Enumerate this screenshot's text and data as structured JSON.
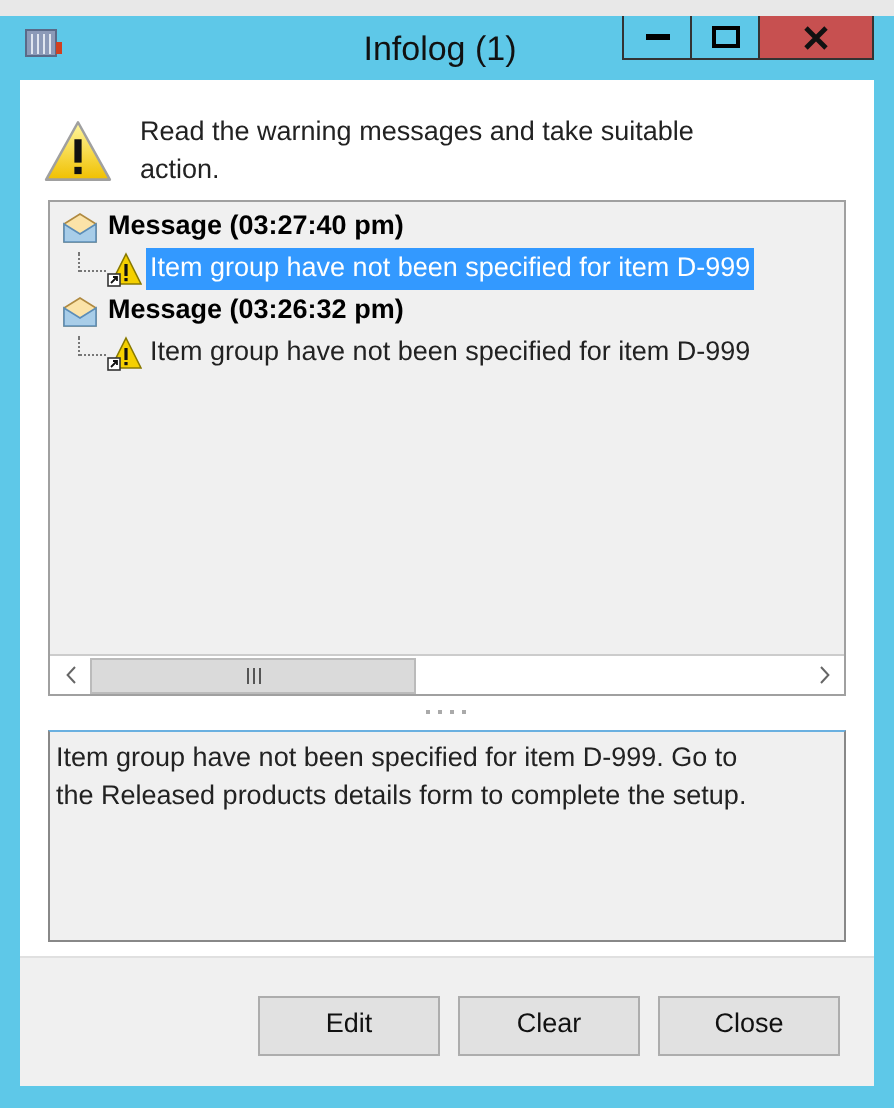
{
  "window": {
    "title": "Infolog (1)"
  },
  "header": {
    "text": "Read the warning messages and take suitable action."
  },
  "messages": [
    {
      "label": "Message (03:27:40 pm)",
      "selected": false,
      "children": [
        {
          "text": "Item group have not been specified for item D-999",
          "selected": true
        }
      ]
    },
    {
      "label": "Message (03:26:32 pm)",
      "selected": false,
      "children": [
        {
          "text": "Item group have not been specified for item D-999",
          "selected": false
        }
      ]
    }
  ],
  "details": {
    "text": "Item group have not been specified for item D-999. Go to the Released products details form to complete the setup."
  },
  "buttons": [
    "Edit",
    "Clear",
    "Close"
  ]
}
